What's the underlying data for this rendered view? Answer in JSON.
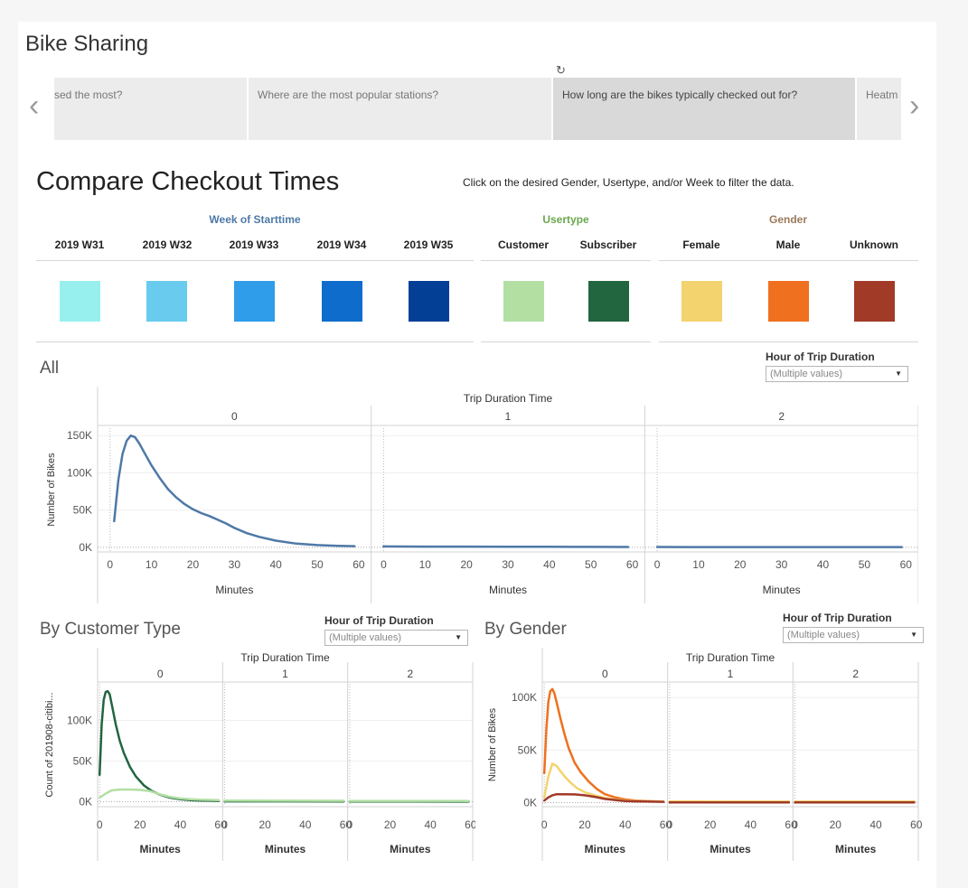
{
  "story": {
    "title": "Bike Sharing",
    "tabs": [
      {
        "label": "sed the most?"
      },
      {
        "label": "Where are the most popular stations?"
      },
      {
        "label": "How long are the bikes typically checked out for?"
      },
      {
        "label": "Heatm"
      }
    ],
    "active_tab": 2
  },
  "dashboard": {
    "title": "Compare Checkout Times",
    "instructions": "Click on the desired Gender, Usertype, and/or Week to filter the data."
  },
  "legends": {
    "week": {
      "title": "Week of Starttime",
      "title_color": "#4e79a7",
      "items": [
        {
          "label": "2019 W31",
          "color": "#98f0ee"
        },
        {
          "label": "2019 W32",
          "color": "#69cbee"
        },
        {
          "label": "2019 W33",
          "color": "#2f9de9"
        },
        {
          "label": "2019 W34",
          "color": "#0e6ccd"
        },
        {
          "label": "2019 W35",
          "color": "#043f96"
        }
      ]
    },
    "usertype": {
      "title": "Usertype",
      "title_color": "#6aa84f",
      "items": [
        {
          "label": "Customer",
          "color": "#b3dfa3"
        },
        {
          "label": "Subscriber",
          "color": "#226640"
        }
      ]
    },
    "gender": {
      "title": "Gender",
      "title_color": "#9c7a5a",
      "items": [
        {
          "label": "Female",
          "color": "#f3d36e"
        },
        {
          "label": "Male",
          "color": "#ef701f"
        },
        {
          "label": "Unknown",
          "color": "#a13a27"
        }
      ]
    }
  },
  "filters": {
    "label": "Hour of Trip Duration",
    "value": "(Multiple values)"
  },
  "sections": {
    "all": "All",
    "customer": "By Customer Type",
    "gender": "By Gender"
  },
  "chart_data": [
    {
      "type": "line",
      "section": "All",
      "facet_title": "Trip Duration Time",
      "facets": [
        "0",
        "1",
        "2"
      ],
      "xlabel": "Minutes",
      "ylabel": "Number of Bikes",
      "x_ticks": [
        0,
        10,
        20,
        30,
        40,
        50,
        60
      ],
      "y_ticks": [
        {
          "v": 0,
          "label": "0K"
        },
        {
          "v": 50000,
          "label": "50K"
        },
        {
          "v": 100000,
          "label": "100K"
        },
        {
          "v": 150000,
          "label": "150K"
        }
      ],
      "xlim": [
        -3,
        63
      ],
      "ylim": [
        -5000,
        160000
      ],
      "series": [
        {
          "color": "#4e79a7",
          "facet_values": [
            [
              [
                1,
                35000
              ],
              [
                2,
                90000
              ],
              [
                3,
                125000
              ],
              [
                4,
                143000
              ],
              [
                5,
                150000
              ],
              [
                6,
                148000
              ],
              [
                7,
                140000
              ],
              [
                8,
                130000
              ],
              [
                10,
                110000
              ],
              [
                12,
                93000
              ],
              [
                14,
                78000
              ],
              [
                16,
                67000
              ],
              [
                18,
                58000
              ],
              [
                20,
                51000
              ],
              [
                22,
                46000
              ],
              [
                24,
                42000
              ],
              [
                26,
                37000
              ],
              [
                28,
                32000
              ],
              [
                30,
                26000
              ],
              [
                33,
                19000
              ],
              [
                36,
                14000
              ],
              [
                40,
                9000
              ],
              [
                45,
                5000
              ],
              [
                50,
                3000
              ],
              [
                55,
                2000
              ],
              [
                59,
                1500
              ]
            ],
            [
              [
                0,
                1200
              ],
              [
                10,
                1000
              ],
              [
                20,
                900
              ],
              [
                30,
                800
              ],
              [
                40,
                700
              ],
              [
                50,
                600
              ],
              [
                59,
                500
              ]
            ],
            [
              [
                0,
                400
              ],
              [
                10,
                380
              ],
              [
                20,
                360
              ],
              [
                30,
                340
              ],
              [
                40,
                320
              ],
              [
                50,
                300
              ],
              [
                59,
                280
              ]
            ]
          ]
        }
      ]
    },
    {
      "type": "line",
      "section": "By Customer Type",
      "facet_title": "Trip Duration Time",
      "facets": [
        "0",
        "1",
        "2"
      ],
      "xlabel": "Minutes",
      "ylabel": "Count of 201908-citibi...",
      "x_ticks": [
        0,
        20,
        40,
        60
      ],
      "y_ticks": [
        {
          "v": 0,
          "label": "0K"
        },
        {
          "v": 50000,
          "label": "50K"
        },
        {
          "v": 100000,
          "label": "100K"
        }
      ],
      "xlim": [
        -1,
        61
      ],
      "ylim": [
        -5000,
        145000
      ],
      "series": [
        {
          "color": "#226640",
          "facet_values": [
            [
              [
                0,
                33000
              ],
              [
                1,
                95000
              ],
              [
                2,
                125000
              ],
              [
                3,
                135000
              ],
              [
                4,
                136000
              ],
              [
                5,
                132000
              ],
              [
                6,
                120000
              ],
              [
                8,
                95000
              ],
              [
                10,
                75000
              ],
              [
                12,
                60000
              ],
              [
                15,
                43000
              ],
              [
                18,
                31000
              ],
              [
                22,
                20000
              ],
              [
                26,
                13000
              ],
              [
                30,
                8500
              ],
              [
                35,
                5000
              ],
              [
                40,
                3000
              ],
              [
                45,
                2000
              ],
              [
                50,
                1500
              ],
              [
                55,
                1200
              ],
              [
                59,
                1000
              ]
            ],
            [
              [
                0,
                500
              ],
              [
                30,
                400
              ],
              [
                59,
                300
              ]
            ],
            [
              [
                0,
                200
              ],
              [
                30,
                180
              ],
              [
                59,
                150
              ]
            ]
          ]
        },
        {
          "color": "#b3dfa3",
          "facet_values": [
            [
              [
                0,
                5000
              ],
              [
                3,
                10000
              ],
              [
                6,
                14000
              ],
              [
                10,
                15000
              ],
              [
                15,
                15000
              ],
              [
                20,
                14500
              ],
              [
                25,
                13000
              ],
              [
                30,
                9000
              ],
              [
                35,
                6000
              ],
              [
                40,
                4000
              ],
              [
                45,
                3000
              ],
              [
                50,
                2500
              ],
              [
                55,
                2200
              ],
              [
                59,
                2000
              ]
            ],
            [
              [
                0,
                1300
              ],
              [
                30,
                1200
              ],
              [
                59,
                1100
              ]
            ],
            [
              [
                0,
                1000
              ],
              [
                30,
                950
              ],
              [
                59,
                900
              ]
            ]
          ]
        }
      ]
    },
    {
      "type": "line",
      "section": "By Gender",
      "facet_title": "Trip Duration Time",
      "facets": [
        "0",
        "1",
        "2"
      ],
      "xlabel": "Minutes",
      "ylabel": "Number of Bikes",
      "x_ticks": [
        0,
        20,
        40,
        60
      ],
      "y_ticks": [
        {
          "v": 0,
          "label": "0K"
        },
        {
          "v": 50000,
          "label": "50K"
        },
        {
          "v": 100000,
          "label": "100K"
        }
      ],
      "xlim": [
        -1,
        61
      ],
      "ylim": [
        -3000,
        113000
      ],
      "series": [
        {
          "color": "#ef701f",
          "facet_values": [
            [
              [
                0,
                28000
              ],
              [
                1,
                70000
              ],
              [
                2,
                96000
              ],
              [
                3,
                106000
              ],
              [
                4,
                108000
              ],
              [
                5,
                104000
              ],
              [
                6,
                96000
              ],
              [
                8,
                80000
              ],
              [
                10,
                65000
              ],
              [
                12,
                52000
              ],
              [
                15,
                38000
              ],
              [
                18,
                29000
              ],
              [
                22,
                20000
              ],
              [
                26,
                13000
              ],
              [
                30,
                8000
              ],
              [
                35,
                5000
              ],
              [
                40,
                3000
              ],
              [
                45,
                2000
              ],
              [
                50,
                1500
              ],
              [
                55,
                1200
              ],
              [
                59,
                1000
              ]
            ],
            [
              [
                0,
                900
              ],
              [
                30,
                800
              ],
              [
                59,
                700
              ]
            ],
            [
              [
                0,
                700
              ],
              [
                30,
                650
              ],
              [
                59,
                600
              ]
            ]
          ]
        },
        {
          "color": "#f3d36e",
          "facet_values": [
            [
              [
                0,
                5000
              ],
              [
                2,
                25000
              ],
              [
                4,
                37000
              ],
              [
                6,
                35000
              ],
              [
                8,
                30000
              ],
              [
                10,
                25000
              ],
              [
                13,
                19000
              ],
              [
                16,
                14000
              ],
              [
                20,
                10000
              ],
              [
                25,
                7000
              ],
              [
                30,
                4500
              ],
              [
                35,
                3000
              ],
              [
                40,
                2000
              ],
              [
                45,
                1500
              ],
              [
                50,
                1200
              ],
              [
                59,
                1000
              ]
            ],
            [
              [
                0,
                1200
              ],
              [
                30,
                1100
              ],
              [
                59,
                1000
              ]
            ],
            [
              [
                0,
                1100
              ],
              [
                30,
                1050
              ],
              [
                59,
                1000
              ]
            ]
          ]
        },
        {
          "color": "#a13a27",
          "facet_values": [
            [
              [
                0,
                2000
              ],
              [
                2,
                5000
              ],
              [
                4,
                7000
              ],
              [
                6,
                8000
              ],
              [
                10,
                8000
              ],
              [
                15,
                7800
              ],
              [
                20,
                7000
              ],
              [
                25,
                5500
              ],
              [
                30,
                3500
              ],
              [
                35,
                2500
              ],
              [
                40,
                1500
              ],
              [
                45,
                1200
              ],
              [
                50,
                1000
              ],
              [
                59,
                800
              ]
            ],
            [
              [
                0,
                300
              ],
              [
                30,
                280
              ],
              [
                59,
                260
              ]
            ],
            [
              [
                0,
                250
              ],
              [
                30,
                240
              ],
              [
                59,
                230
              ]
            ]
          ]
        }
      ]
    }
  ]
}
